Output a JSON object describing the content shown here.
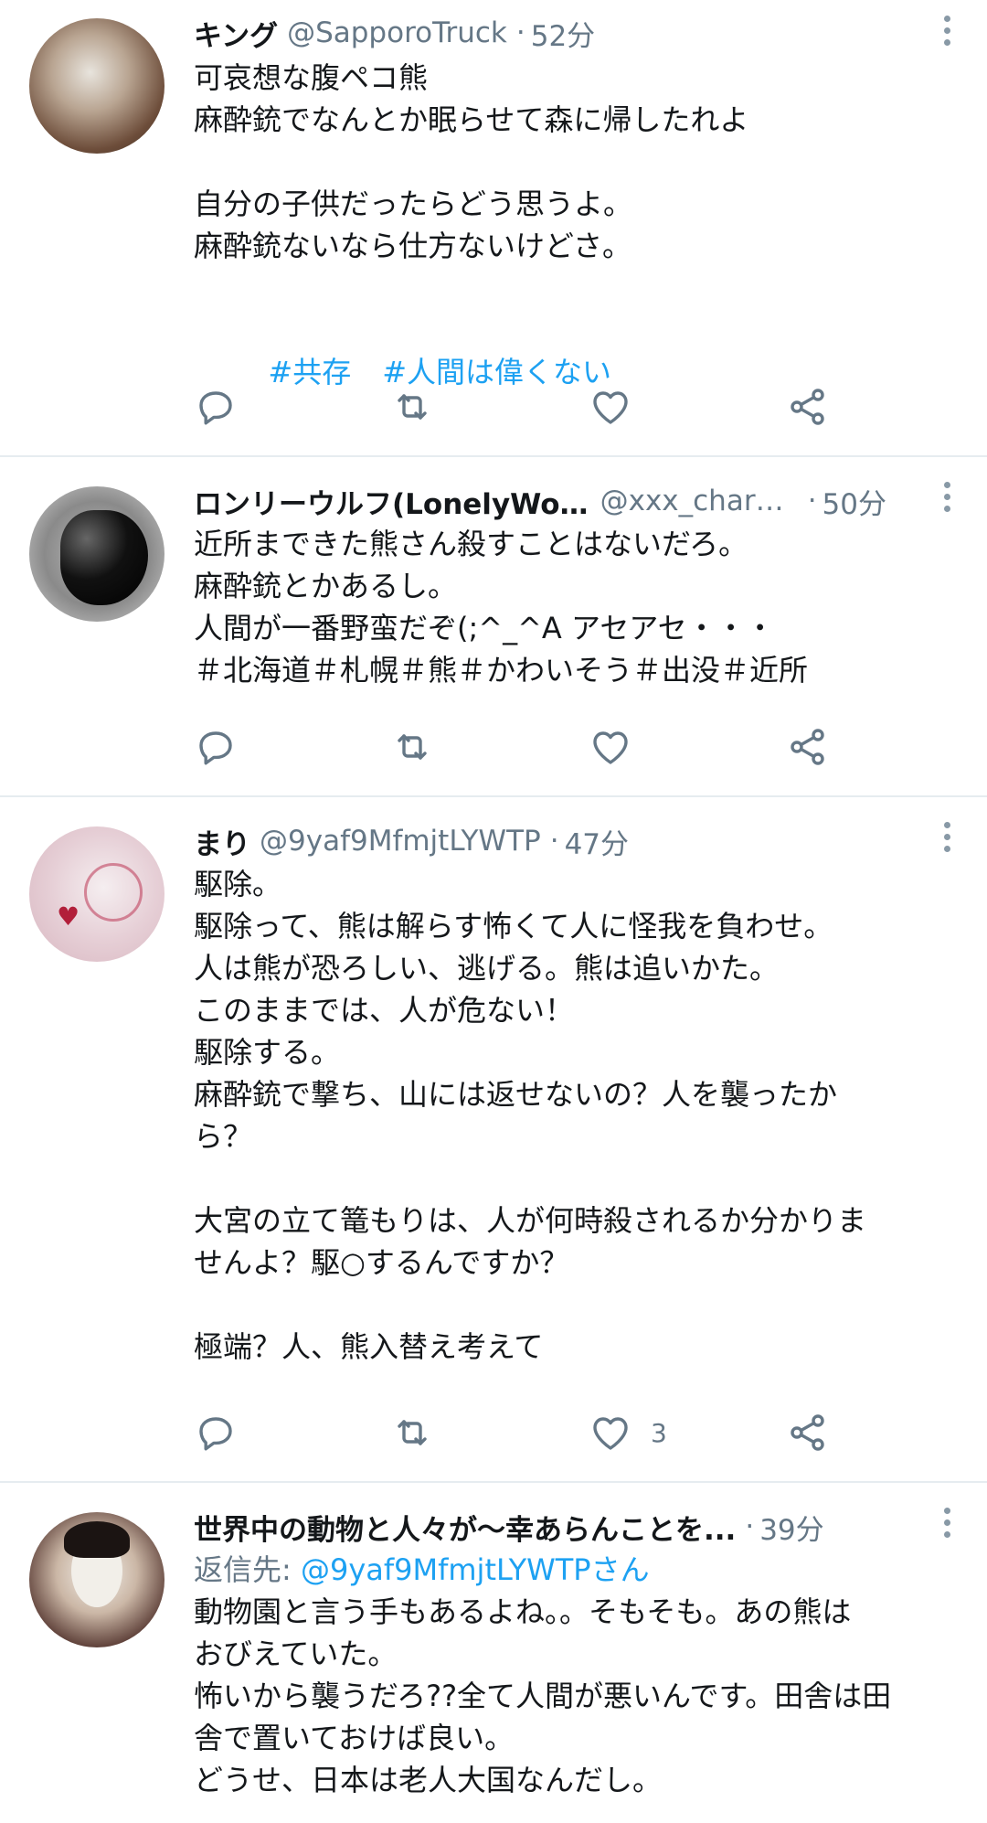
{
  "tweets": [
    {
      "name": "キング",
      "handle": "@SapporoTruck",
      "separator": "·",
      "time": "52分",
      "lines": [
        "可哀想な腹ペコ熊",
        "麻酔銃でなんとか眠らせて森に帰したれよ",
        "",
        "自分の子供だったらどう思うよ。",
        "麻酔銃ないなら仕方ないけどさ。",
        ""
      ],
      "hashtags": [
        "#共存",
        "#人間は偉くない"
      ],
      "like_count": ""
    },
    {
      "name": "ロンリーウルフ(LonelyWolf)",
      "handle": "@xxx_charb...",
      "separator": "·",
      "time": "50分",
      "lines": [
        "近所まできた熊さん殺すことはないだろ。",
        "麻酔銃とかあるし。",
        "人間が一番野蛮だぞ(;^_^A アセアセ・・・",
        "＃北海道＃札幌＃熊＃かわいそう＃出没＃近所"
      ],
      "like_count": ""
    },
    {
      "name": "まり",
      "handle": "@9yaf9MfmjtLYWTP",
      "separator": "·",
      "time": "47分",
      "lines": [
        "駆除。",
        "駆除って、熊は解らす怖くて人に怪我を負わせ。",
        "人は熊が恐ろしい、逃げる。熊は追いかた。",
        "このままでは、人が危ない！",
        "駆除する。",
        "麻酔銃で撃ち、山には返せないの？人を襲ったか",
        "ら？",
        "",
        "大宮の立て篭もりは、人が何時殺されるか分かりま",
        "せんよ？駆○するんですか？",
        "",
        "極端？人、熊入替え考えて"
      ],
      "like_count": "3"
    },
    {
      "name": "世界中の動物と人々が～幸あらんことを...",
      "handle": "",
      "separator": "·",
      "time": "39分",
      "reply_prefix": "返信先: ",
      "reply_mention": "@9yaf9MfmjtLYWTPさん",
      "lines": [
        "動物園と言う手もあるよね。。そもそも。あの熊は",
        "おびえていた。",
        "怖いから襲うだろ??全て人間が悪いんです。田舎は田",
        "舎で置いておけば良い。",
        "どうせ、日本は老人大国なんだし。"
      ]
    }
  ],
  "colors": {
    "link": "#1da1f2",
    "secondary": "#657786",
    "text": "#14171a",
    "divider": "#e6ecf0"
  },
  "icons": [
    "reply-icon",
    "retweet-icon",
    "like-icon",
    "share-icon",
    "more-options-icon"
  ]
}
